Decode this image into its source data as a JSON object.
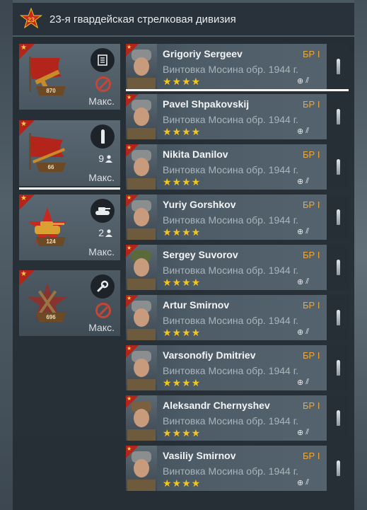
{
  "header": {
    "division_name": "23-я гвардейская стрелковая дивизия",
    "badge_number": "23"
  },
  "squads": [
    {
      "level": "870",
      "type_icon": "list-icon",
      "max_label": "Макс.",
      "locked": true,
      "count": ""
    },
    {
      "level": "66",
      "type_icon": "bullet-icon",
      "max_label": "Макс.",
      "locked": false,
      "count": "9"
    },
    {
      "level": "124",
      "type_icon": "tank-icon",
      "max_label": "Макс.",
      "locked": false,
      "count": "2"
    },
    {
      "level": "696",
      "type_icon": "wrench-icon",
      "max_label": "Макс.",
      "locked": true,
      "count": ""
    }
  ],
  "soldiers": [
    {
      "name": "Grigoriy Sergeev",
      "br": "БР I",
      "weapon": "Винтовка Мосина обр. 1944 г.",
      "stars": "★★★★"
    },
    {
      "name": "Pavel Shpakovskij",
      "br": "БР I",
      "weapon": "Винтовка Мосина обр. 1944 г.",
      "stars": "★★★★"
    },
    {
      "name": "Nikita Danilov",
      "br": "БР I",
      "weapon": "Винтовка Мосина обр. 1944 г.",
      "stars": "★★★★"
    },
    {
      "name": "Yuriy Gorshkov",
      "br": "БР I",
      "weapon": "Винтовка Мосина обр. 1944 г.",
      "stars": "★★★★"
    },
    {
      "name": "Sergey Suvorov",
      "br": "БР I",
      "weapon": "Винтовка Мосина обр. 1944 г.",
      "stars": "★★★★"
    },
    {
      "name": "Artur Smirnov",
      "br": "БР I",
      "weapon": "Винтовка Мосина обр. 1944 г.",
      "stars": "★★★★"
    },
    {
      "name": "Varsonofiy Dmitriev",
      "br": "БР I",
      "weapon": "Винтовка Мосина обр. 1944 г.",
      "stars": "★★★★"
    },
    {
      "name": "Aleksandr Chernyshev",
      "br": "БР I",
      "weapon": "Винтовка Мосина обр. 1944 г.",
      "stars": "★★★★"
    },
    {
      "name": "Vasiliy Smirnov",
      "br": "БР I",
      "weapon": "Винтовка Мосина обр. 1944 г.",
      "stars": "★★★★"
    }
  ],
  "colors": {
    "accent_red": "#b3241b",
    "br_orange": "#f0a531",
    "star_gold": "#f2c521",
    "locked_red": "#c74535"
  }
}
